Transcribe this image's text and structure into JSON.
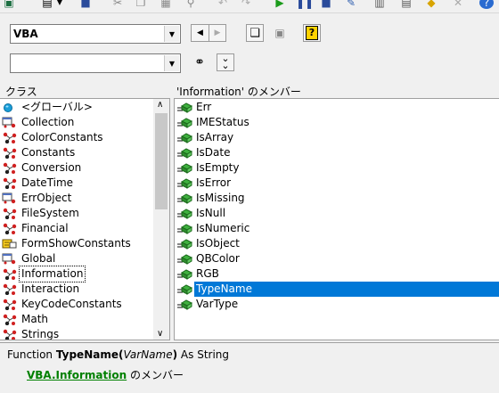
{
  "toolbar_icons": [
    "excel-icon",
    "insert-module-icon",
    "save-icon",
    "cut-icon",
    "copy-icon",
    "paste-icon",
    "find-icon",
    "undo-icon",
    "redo-icon",
    "run-icon",
    "break-icon",
    "reset-icon",
    "design-mode-icon",
    "project-explorer-icon",
    "properties-icon",
    "object-browser-icon",
    "toolbox-icon",
    "help-icon"
  ],
  "library_combo": {
    "value": "VBA"
  },
  "search_combo": {
    "value": ""
  },
  "buttons": {
    "back": "◀",
    "forward": "▶",
    "copy": "copy",
    "view_definition": "view",
    "help": "?",
    "search": "binoculars",
    "toggle": "≚"
  },
  "classes_header": "クラス",
  "classes": [
    {
      "name": "<グローバル>",
      "icon": "globe"
    },
    {
      "name": "Collection",
      "icon": "class"
    },
    {
      "name": "ColorConstants",
      "icon": "module"
    },
    {
      "name": "Constants",
      "icon": "module"
    },
    {
      "name": "Conversion",
      "icon": "module"
    },
    {
      "name": "DateTime",
      "icon": "module"
    },
    {
      "name": "ErrObject",
      "icon": "class"
    },
    {
      "name": "FileSystem",
      "icon": "module"
    },
    {
      "name": "Financial",
      "icon": "module"
    },
    {
      "name": "FormShowConstants",
      "icon": "enum"
    },
    {
      "name": "Global",
      "icon": "class"
    },
    {
      "name": "Information",
      "icon": "module"
    },
    {
      "name": "Interaction",
      "icon": "module"
    },
    {
      "name": "KeyCodeConstants",
      "icon": "module"
    },
    {
      "name": "Math",
      "icon": "module"
    },
    {
      "name": "Strings",
      "icon": "module"
    }
  ],
  "members_header": "'Information' のメンバー",
  "members": [
    "Err",
    "IMEStatus",
    "IsArray",
    "IsDate",
    "IsEmpty",
    "IsError",
    "IsMissing",
    "IsNull",
    "IsNumeric",
    "IsObject",
    "QBColor",
    "RGB",
    "TypeName",
    "VarType"
  ],
  "selected_member": "TypeName",
  "details": {
    "keyword": "Function",
    "name": "TypeName",
    "open_paren": "(",
    "param": "VarName",
    "close_paren": ")",
    "returns": "As String",
    "library_link": "VBA",
    "dot": ".",
    "class_link": "Information",
    "member_of": "のメンバー"
  },
  "colors": {
    "selection": "#0078d7",
    "link": "#008000",
    "method_icon": "#2e9b2e"
  }
}
